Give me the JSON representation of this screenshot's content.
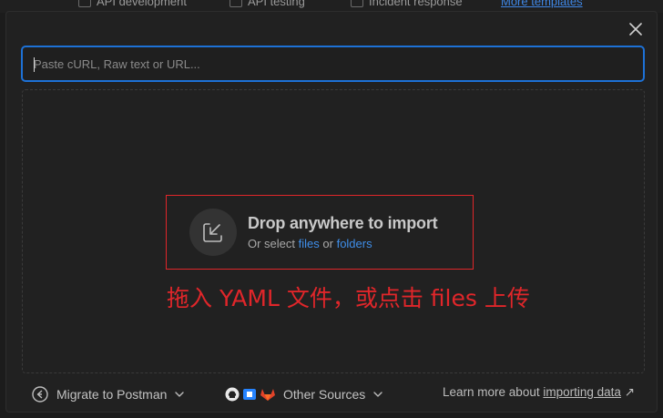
{
  "background": {
    "chips": [
      {
        "label": "API development"
      },
      {
        "label": "API testing"
      },
      {
        "label": "Incident response"
      },
      {
        "label": "More templates"
      }
    ]
  },
  "modal": {
    "close_icon": "close-icon",
    "input": {
      "placeholder": "Paste cURL, Raw text or URL...",
      "value": ""
    },
    "drop": {
      "icon": "import-icon",
      "title": "Drop anywhere to import",
      "sub_prefix": "Or select",
      "files_link": "files",
      "or_word": "or",
      "folders_link": "folders"
    },
    "annotation": "拖入 YAML 文件，或点击 files 上传",
    "footer": {
      "migrate_label": "Migrate to Postman",
      "other_sources_label": "Other Sources",
      "learn_prefix": "Learn more about",
      "learn_link": "importing data",
      "learn_arrow": "↗"
    }
  },
  "colors": {
    "accent": "#1d71d6",
    "link": "#3f8ee9",
    "annotation": "#e0262a",
    "gitlab": "#e24329",
    "bitbucket": "#2684ff"
  }
}
